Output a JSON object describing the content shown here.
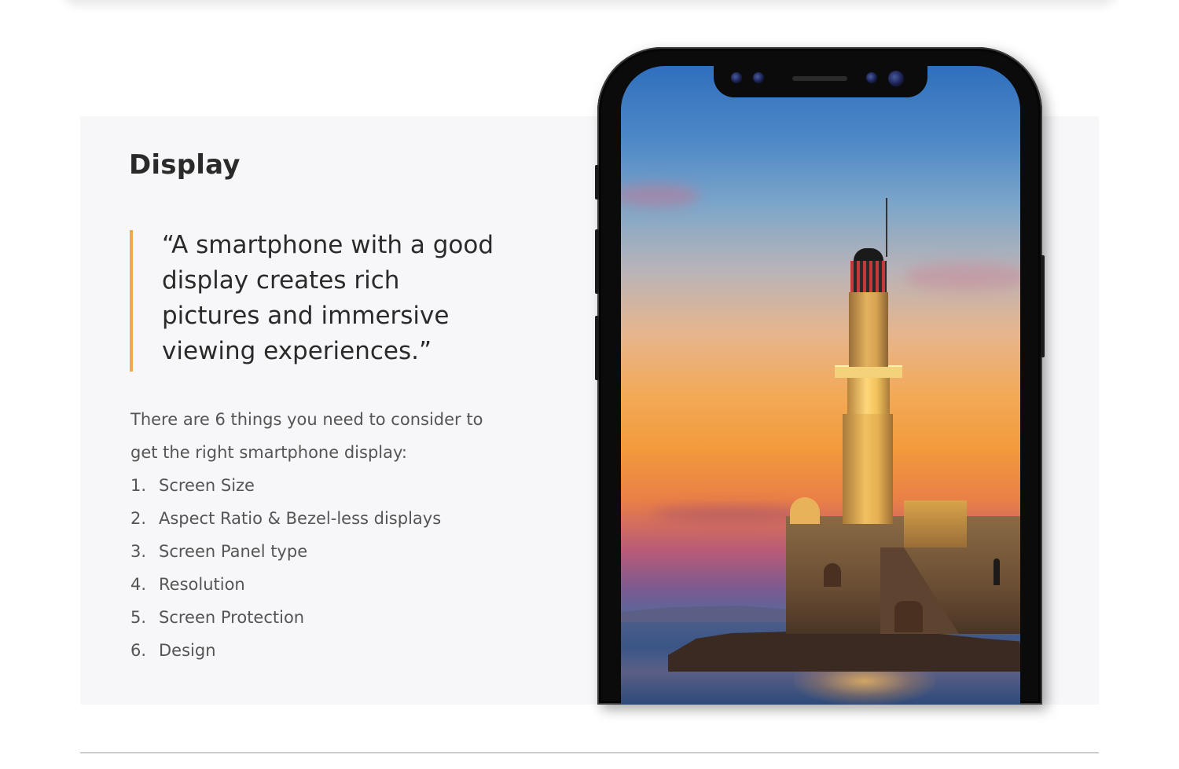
{
  "section": {
    "title": "Display"
  },
  "quote": {
    "text": "“A smartphone with a good display creates rich pictures and immersive viewing experiences.”"
  },
  "intro": {
    "text": "There are 6 things you need to consider to get the right smartphone display:"
  },
  "considerations": [
    {
      "number": "1.",
      "label": "Screen Size"
    },
    {
      "number": "2.",
      "label": "Aspect Ratio & Bezel-less displays"
    },
    {
      "number": "3.",
      "label": "Screen Panel type"
    },
    {
      "number": "4.",
      "label": "Resolution"
    },
    {
      "number": "5.",
      "label": "Screen Protection"
    },
    {
      "number": "6.",
      "label": "Design"
    }
  ],
  "colors": {
    "panel_background": "#f7f7f9",
    "quote_accent": "#f3a847",
    "title_text": "#2a2a2a",
    "body_text": "#555555"
  },
  "image": {
    "subject": "smartphone showing lighthouse at sunset"
  }
}
